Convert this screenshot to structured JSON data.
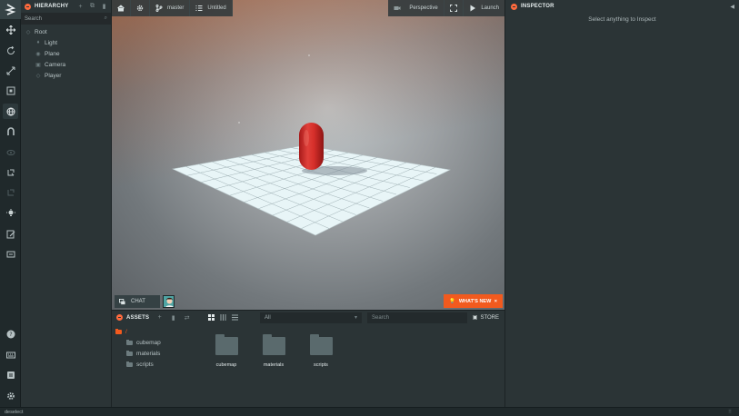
{
  "colors": {
    "accent": "#f25a1e",
    "panel": "#2b3436",
    "toolbar": "#20292b",
    "capsule": "#d8322d",
    "grid": "#e6f3f5"
  },
  "toolbar": {
    "logo_icon": "playcanvas-logo",
    "tools": [
      {
        "name": "move-icon",
        "active": false
      },
      {
        "name": "rotate-icon",
        "active": false
      },
      {
        "name": "scale-icon",
        "active": false
      },
      {
        "name": "resize-icon",
        "active": false
      },
      {
        "name": "world-space-icon",
        "active": true
      },
      {
        "name": "magnet-snap-icon",
        "active": false
      },
      {
        "name": "frame-selection-icon",
        "active": false
      },
      {
        "name": "undo-icon",
        "active": false
      },
      {
        "name": "redo-icon",
        "active": false
      },
      {
        "name": "lightmapper-icon",
        "active": false
      },
      {
        "name": "code-editor-icon",
        "active": false
      },
      {
        "name": "publish-icon",
        "active": false
      }
    ],
    "bottom_tools": [
      "help-icon",
      "controls-icon",
      "feedback-icon",
      "settings-icon"
    ]
  },
  "hierarchy": {
    "title": "HIERARCHY",
    "search_placeholder": "Search",
    "root": "Root",
    "items": [
      "Light",
      "Plane",
      "Camera",
      "Player"
    ]
  },
  "viewport": {
    "branch": "master",
    "scene": "Untitled",
    "camera": "Perspective",
    "launch": "Launch",
    "chat": "CHAT",
    "whats_new": "WHAT'S NEW"
  },
  "assets": {
    "title": "ASSETS",
    "filter": "All",
    "search_placeholder": "Search",
    "store": "STORE",
    "root_path": "/",
    "tree": [
      "cubemap",
      "materials",
      "scripts"
    ],
    "grid": [
      "cubemap",
      "materials",
      "scripts"
    ]
  },
  "inspector": {
    "title": "INSPECTOR",
    "empty_message": "Select anything to Inspect"
  },
  "status": {
    "text": "deselect"
  }
}
